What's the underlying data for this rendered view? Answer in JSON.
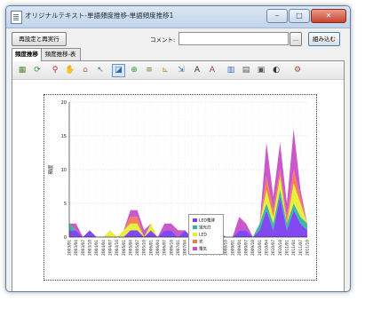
{
  "window": {
    "title": "オリジナルテキスト-単語頻度推移-単語頻度推移1",
    "buttons": {
      "minimize": "‒",
      "maximize": "□",
      "close": "✕"
    }
  },
  "controls": {
    "reconfigure_label": "再設定と再実行",
    "comment_label": "コメント:",
    "comment_value": "",
    "ellipsis_label": "...",
    "load_label": "組み込む"
  },
  "tabs": [
    {
      "label": "頻度推移",
      "active": true
    },
    {
      "label": "頻度推移-表",
      "active": false
    }
  ],
  "toolbar": {
    "icons": [
      "grid-icon",
      "refresh-icon",
      "zoom-icon",
      "pan-icon",
      "home-icon",
      "arrow-icon",
      "chart-type-icon",
      "add-icon",
      "filter-icon",
      "axis-icon",
      "scale-icon",
      "font-icon",
      "text-icon",
      "bar-chart-icon",
      "table-icon",
      "export-icon",
      "pie-icon",
      "settings-icon"
    ]
  },
  "colors": {
    "series": [
      "#7b3ff2",
      "#2fb6a0",
      "#e6ef35",
      "#f27a4c",
      "#c84fc8"
    ]
  },
  "chart_data": {
    "type": "area",
    "stacked": true,
    "title": "",
    "xlabel": "",
    "ylabel": "頻度",
    "ylim": [
      0,
      20
    ],
    "yticks": [
      0,
      5,
      10,
      15,
      20
    ],
    "grid": true,
    "legend_position": "right-center",
    "categories": [
      "2003/01",
      "2003/04",
      "2003/07",
      "2003/10",
      "2004/01",
      "2004/04",
      "2004/07",
      "2004/10",
      "2005/01",
      "2005/04",
      "2005/07",
      "2005/10",
      "2006/01",
      "2006/04",
      "2006/07",
      "2006/10",
      "2007/01",
      "2007/04",
      "2007/07",
      "2007/10",
      "2008/01",
      "2008/04",
      "2008/07",
      "2008/10",
      "2009/01",
      "2009/04",
      "2009/07",
      "2009/10",
      "2010/01",
      "2010/04",
      "2010/07",
      "2010/10",
      "2011/01",
      "2011/04",
      "2011/07",
      "2011/10"
    ],
    "series": [
      {
        "name": "LED電球",
        "values": [
          1,
          1,
          0,
          1,
          0,
          0,
          0,
          0,
          0,
          1,
          1,
          0,
          1,
          0,
          1,
          1,
          0,
          1,
          0,
          0,
          0,
          0,
          1,
          0,
          0,
          1,
          1,
          0,
          1,
          4,
          1,
          6,
          1,
          4,
          2,
          1
        ]
      },
      {
        "name": "蛍光灯",
        "values": [
          1,
          0,
          0,
          0,
          0,
          0,
          0,
          0,
          0,
          0,
          0,
          0,
          0,
          0,
          0,
          0,
          0,
          0,
          0,
          0,
          0,
          0,
          0,
          0,
          0,
          0,
          0,
          0,
          1,
          1,
          1,
          1,
          1,
          1,
          1,
          1
        ]
      },
      {
        "name": "LED",
        "values": [
          0,
          0,
          0,
          0,
          0,
          0,
          1,
          0,
          1,
          1,
          1,
          0,
          1,
          0,
          0,
          0,
          0,
          0,
          0,
          0,
          0,
          0,
          0,
          0,
          0,
          0,
          0,
          0,
          0,
          2,
          1,
          2,
          0,
          3,
          2,
          0
        ]
      },
      {
        "name": "光",
        "values": [
          0,
          0,
          0,
          0,
          0,
          0,
          0,
          0,
          0,
          1,
          1,
          0,
          0,
          0,
          0,
          0,
          0,
          0,
          0,
          0,
          0,
          0,
          0,
          0,
          0,
          0,
          0,
          0,
          0,
          2,
          1,
          1,
          1,
          2,
          1,
          0
        ]
      },
      {
        "name": "電気",
        "values": [
          0,
          1,
          0,
          0,
          0,
          0,
          0,
          0,
          0,
          1,
          1,
          1,
          0,
          0,
          1,
          1,
          1,
          0,
          0,
          0,
          0,
          0,
          0,
          0,
          0,
          2,
          1,
          0,
          0,
          5,
          2,
          4,
          2,
          6,
          1,
          0
        ]
      }
    ]
  }
}
